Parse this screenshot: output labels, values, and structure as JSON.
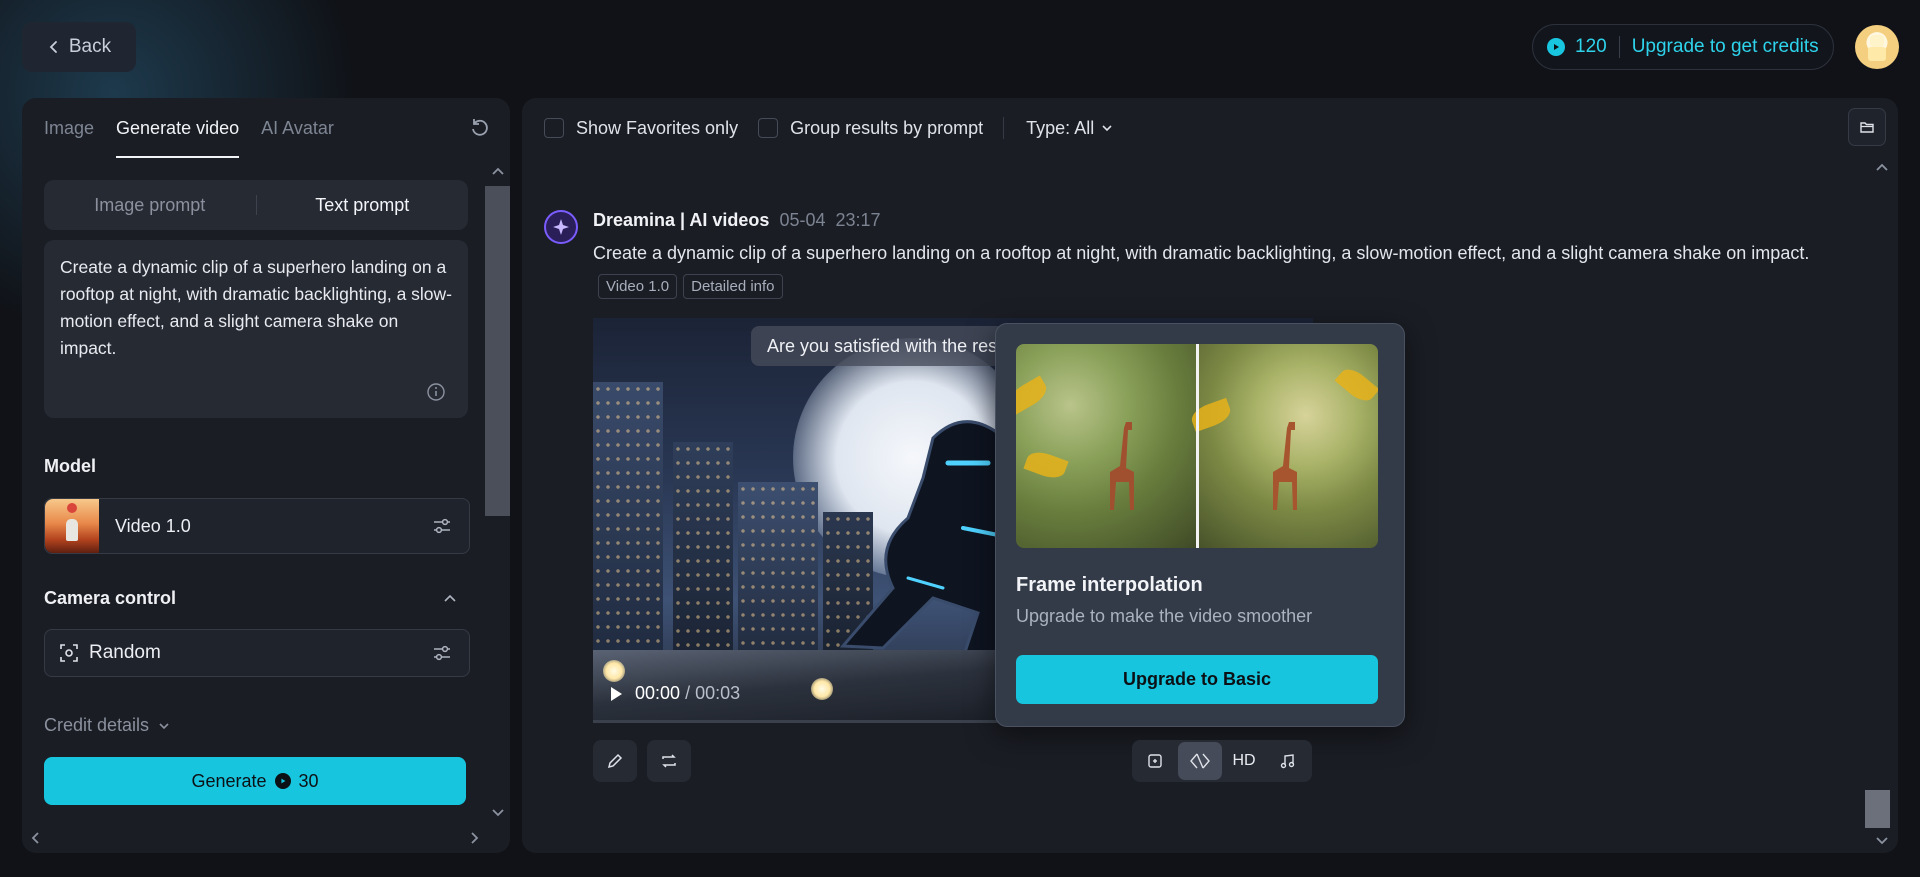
{
  "header": {
    "back_label": "Back",
    "credits_count": "120",
    "upgrade_label": "Upgrade to get credits"
  },
  "sidebar": {
    "tabs": [
      "Image",
      "Generate video",
      "AI Avatar"
    ],
    "prompt_modes": [
      "Image prompt",
      "Text prompt"
    ],
    "prompt_text": "Create a dynamic clip of a superhero landing on a rooftop at night, with dramatic backlighting, a slow-motion effect, and a slight camera shake on impact.",
    "model_label": "Model",
    "model_name": "Video 1.0",
    "camera_label": "Camera control",
    "camera_value": "Random",
    "credit_details_label": "Credit details",
    "generate_label": "Generate",
    "generate_cost": "30"
  },
  "filters": {
    "favorites_label": "Show Favorites only",
    "group_label": "Group results by prompt",
    "type_label": "Type: All"
  },
  "message": {
    "sender": "Dreamina | AI videos",
    "date": "05-04",
    "time": "23:17",
    "prompt": "Create a dynamic clip of a superhero landing on a rooftop at night, with dramatic backlighting, a slow-motion effect, and a slight camera shake on impact.",
    "tags": [
      "Video 1.0",
      "Detailed info"
    ],
    "satisfied_text": "Are you satisfied with the resu",
    "current_time": "00:00",
    "duration": "/ 00:03",
    "toolbar_hd": "HD"
  },
  "popover": {
    "title": "Frame interpolation",
    "description": "Upgrade to make the video smoother",
    "button_label": "Upgrade to Basic"
  },
  "colors": {
    "accent": "#17c5de",
    "background": "#101217",
    "panel": "#1a1d24"
  }
}
